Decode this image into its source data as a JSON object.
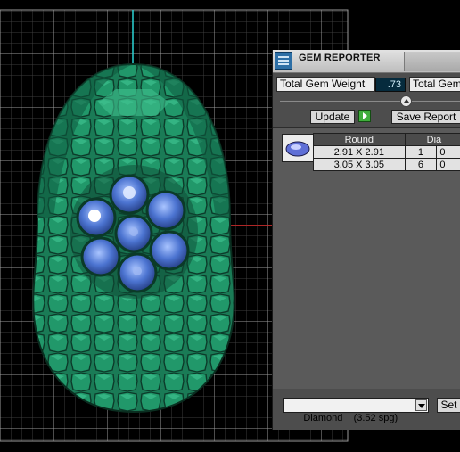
{
  "panel": {
    "title": "GEM REPORTER",
    "total_gem_weight_label": "Total Gem Weight",
    "total_gem_weight_value": ".73",
    "total_gem_label_2": "Total Gem",
    "update_label": "Update",
    "save_report_label": "Save Report",
    "table": {
      "headers": [
        "Round",
        "Dia"
      ],
      "rows": [
        [
          "2.91 X 2.91",
          "1",
          "0"
        ],
        [
          "3.05 X 3.05",
          "6",
          "0"
        ]
      ]
    },
    "material_select": "Diamond    (3.52 spg)",
    "set_label": "Set"
  },
  "colors": {
    "grid": "#c8c8c8",
    "axis_vertical": "#2bd4d4",
    "axis_horizontal": "#d41f1f",
    "metal": "#188058",
    "gem": "#4b73cc"
  },
  "icons": [
    "gem-reporter-icon",
    "gem-shape-icon",
    "play-icon",
    "dropdown-arrow-icon"
  ]
}
